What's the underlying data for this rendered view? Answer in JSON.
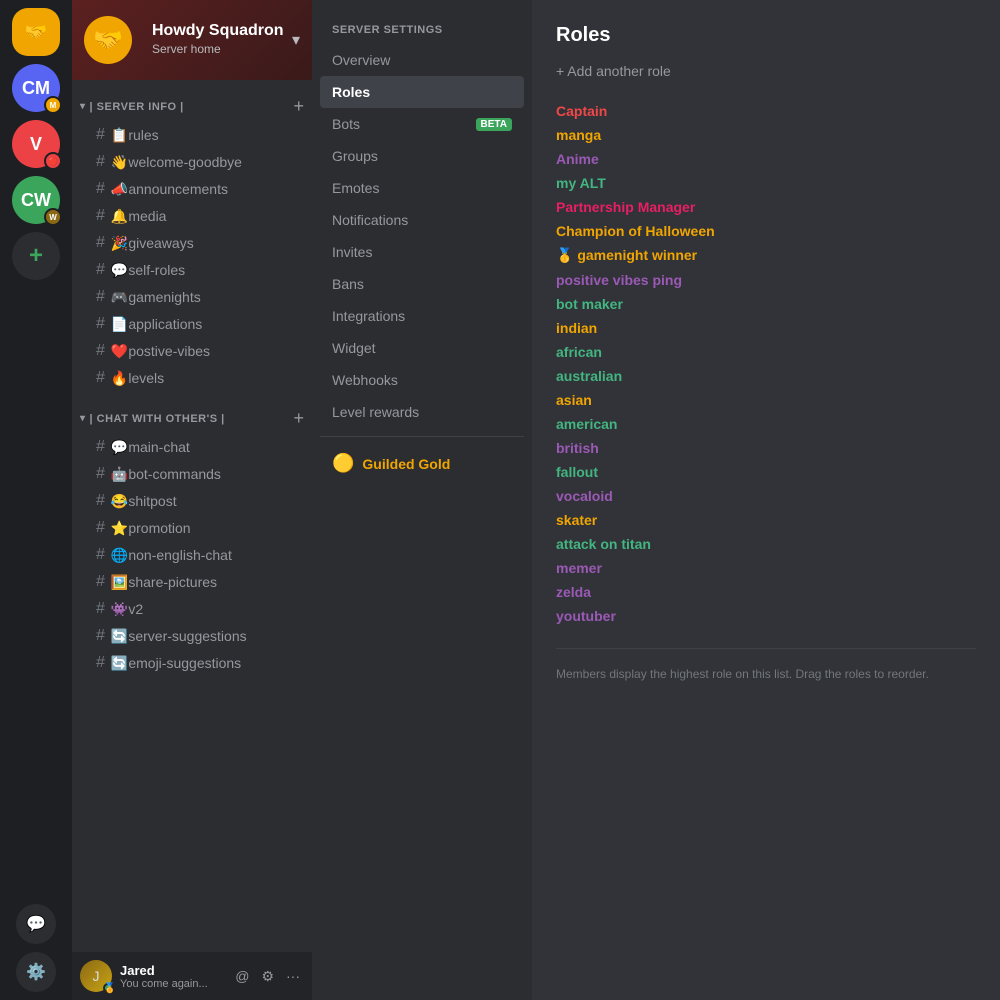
{
  "serverIcons": [
    {
      "id": "howdy",
      "label": "🤝",
      "bg": "#f0a500",
      "active": true,
      "badge": null
    },
    {
      "id": "cm",
      "label": "CM",
      "bg": "#5865f2",
      "active": false,
      "badge": "🟡"
    },
    {
      "id": "v",
      "label": "V",
      "bg": "#ed4245",
      "active": false,
      "badge": "🔴"
    },
    {
      "id": "cw",
      "label": "CW",
      "bg": "#3ba55c",
      "active": false,
      "badge": "🟤"
    }
  ],
  "server": {
    "name": "Howdy Squadron",
    "subtext": "Server home",
    "emoji": "🤝"
  },
  "categories": [
    {
      "id": "server-info",
      "label": "| Server Info |",
      "channels": [
        {
          "emoji": "📋",
          "name": "rules"
        },
        {
          "emoji": "👋",
          "name": "welcome-goodbye"
        },
        {
          "emoji": "📣",
          "name": "announcements"
        },
        {
          "emoji": "🔔",
          "name": "media"
        },
        {
          "emoji": "🎉",
          "name": "giveaways"
        },
        {
          "emoji": "💬",
          "name": "self-roles"
        },
        {
          "emoji": "🎮",
          "name": "gamenights"
        },
        {
          "emoji": "📄",
          "name": "applications"
        },
        {
          "emoji": "❤️",
          "name": "postive-vibes"
        },
        {
          "emoji": "🔥",
          "name": "levels"
        }
      ]
    },
    {
      "id": "chat-with-others",
      "label": "| Chat With other's |",
      "channels": [
        {
          "emoji": "💬",
          "name": "main-chat"
        },
        {
          "emoji": "🤖",
          "name": "bot-commands"
        },
        {
          "emoji": "😂",
          "name": "shitpost"
        },
        {
          "emoji": "⭐",
          "name": "promotion"
        },
        {
          "emoji": "🌐",
          "name": "non-english-chat"
        },
        {
          "emoji": "🖼️",
          "name": "share-pictures"
        },
        {
          "emoji": "👾",
          "name": "v2"
        },
        {
          "emoji": "🔄",
          "name": "server-suggestions"
        },
        {
          "emoji": "🔄",
          "name": "emoji-suggestions"
        }
      ]
    }
  ],
  "user": {
    "name": "Jared",
    "status": "You come again...",
    "statusEmoji": "🏅"
  },
  "settingsMenu": {
    "title": "Server Settings",
    "items": [
      {
        "id": "overview",
        "label": "Overview",
        "active": false,
        "badge": null
      },
      {
        "id": "roles",
        "label": "Roles",
        "active": true,
        "badge": null
      },
      {
        "id": "bots",
        "label": "Bots",
        "active": false,
        "badge": "BETA"
      },
      {
        "id": "groups",
        "label": "Groups",
        "active": false,
        "badge": null
      },
      {
        "id": "emotes",
        "label": "Emotes",
        "active": false,
        "badge": null
      },
      {
        "id": "notifications",
        "label": "Notifications",
        "active": false,
        "badge": null
      },
      {
        "id": "invites",
        "label": "Invites",
        "active": false,
        "badge": null
      },
      {
        "id": "bans",
        "label": "Bans",
        "active": false,
        "badge": null
      },
      {
        "id": "integrations",
        "label": "Integrations",
        "active": false,
        "badge": null
      },
      {
        "id": "widget",
        "label": "Widget",
        "active": false,
        "badge": null
      },
      {
        "id": "webhooks",
        "label": "Webhooks",
        "active": false,
        "badge": null
      },
      {
        "id": "level-rewards",
        "label": "Level rewards",
        "active": false,
        "badge": null
      }
    ],
    "guilded": {
      "label": "Guilded Gold",
      "emoji": "🟡"
    }
  },
  "roles": {
    "title": "Roles",
    "addLabel": "+ Add another role",
    "items": [
      {
        "name": "Captain",
        "color": "#f04747"
      },
      {
        "name": "manga",
        "color": "#f0a500"
      },
      {
        "name": "Anime",
        "color": "#9b59b6"
      },
      {
        "name": "my ALT",
        "color": "#43b581"
      },
      {
        "name": "Partnership Manager",
        "color": "#e91e63"
      },
      {
        "name": "Champion of Halloween",
        "color": "#f0a500"
      },
      {
        "name": "🥇 gamenight winner",
        "color": "#f0a500"
      },
      {
        "name": "positive vibes ping",
        "color": "#9b59b6"
      },
      {
        "name": "bot maker",
        "color": "#43b581"
      },
      {
        "name": "indian",
        "color": "#f0a500"
      },
      {
        "name": "african",
        "color": "#43b581"
      },
      {
        "name": "australian",
        "color": "#43b581"
      },
      {
        "name": "asian",
        "color": "#f0a500"
      },
      {
        "name": "american",
        "color": "#43b581"
      },
      {
        "name": "british",
        "color": "#9b59b6"
      },
      {
        "name": "fallout",
        "color": "#43b581"
      },
      {
        "name": "vocaloid",
        "color": "#9b59b6"
      },
      {
        "name": "skater",
        "color": "#f0a500"
      },
      {
        "name": "attack on titan",
        "color": "#43b581"
      },
      {
        "name": "memer",
        "color": "#9b59b6"
      },
      {
        "name": "zelda",
        "color": "#9b59b6"
      },
      {
        "name": "youtuber",
        "color": "#9b59b6"
      }
    ],
    "hint": "Members display the highest role on this list. Drag the roles to reorder."
  }
}
